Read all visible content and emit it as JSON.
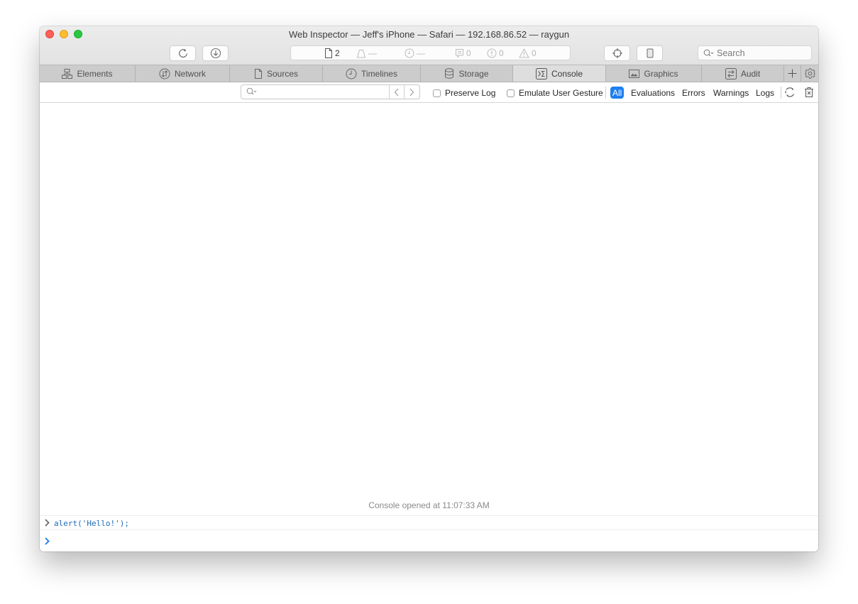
{
  "window": {
    "title": "Web Inspector — Jeff's iPhone — Safari — 192.168.86.52 — raygun"
  },
  "toolbar": {
    "reload_icon": "reload-icon",
    "download_icon": "download-icon",
    "dashboard": {
      "resources_count": "2",
      "resources_size": "—",
      "load_time": "—",
      "logs_count": "0",
      "errors_count": "0",
      "warnings_count": "0"
    },
    "inspect_icon": "crosshair-icon",
    "device_icon": "device-icon",
    "search_placeholder": "Search"
  },
  "tabs": [
    {
      "label": "Elements",
      "icon": "elements-icon",
      "active": false
    },
    {
      "label": "Network",
      "icon": "network-icon",
      "active": false
    },
    {
      "label": "Sources",
      "icon": "document-icon",
      "active": false
    },
    {
      "label": "Timelines",
      "icon": "clock-icon",
      "active": false
    },
    {
      "label": "Storage",
      "icon": "database-icon",
      "active": false
    },
    {
      "label": "Console",
      "icon": "console-icon",
      "active": true
    },
    {
      "label": "Graphics",
      "icon": "image-icon",
      "active": false
    },
    {
      "label": "Audit",
      "icon": "audit-icon",
      "active": false
    }
  ],
  "tabbar_actions": {
    "add_icon": "plus-icon",
    "settings_icon": "gear-icon"
  },
  "filterbar": {
    "filter_value": "",
    "preserve_log_label": "Preserve Log",
    "preserve_log_checked": false,
    "emulate_gesture_label": "Emulate User Gesture",
    "emulate_gesture_checked": false,
    "levels": [
      "All",
      "Evaluations",
      "Errors",
      "Warnings",
      "Logs"
    ],
    "active_level": "All"
  },
  "console": {
    "opened_message": "Console opened at 11:07:33 AM",
    "entries": [
      {
        "type": "evaluation",
        "text": "alert('Hello!');"
      }
    ],
    "prompt_value": ""
  },
  "colors": {
    "accent": "#1d7ff0",
    "code": "#1e6bb8"
  }
}
